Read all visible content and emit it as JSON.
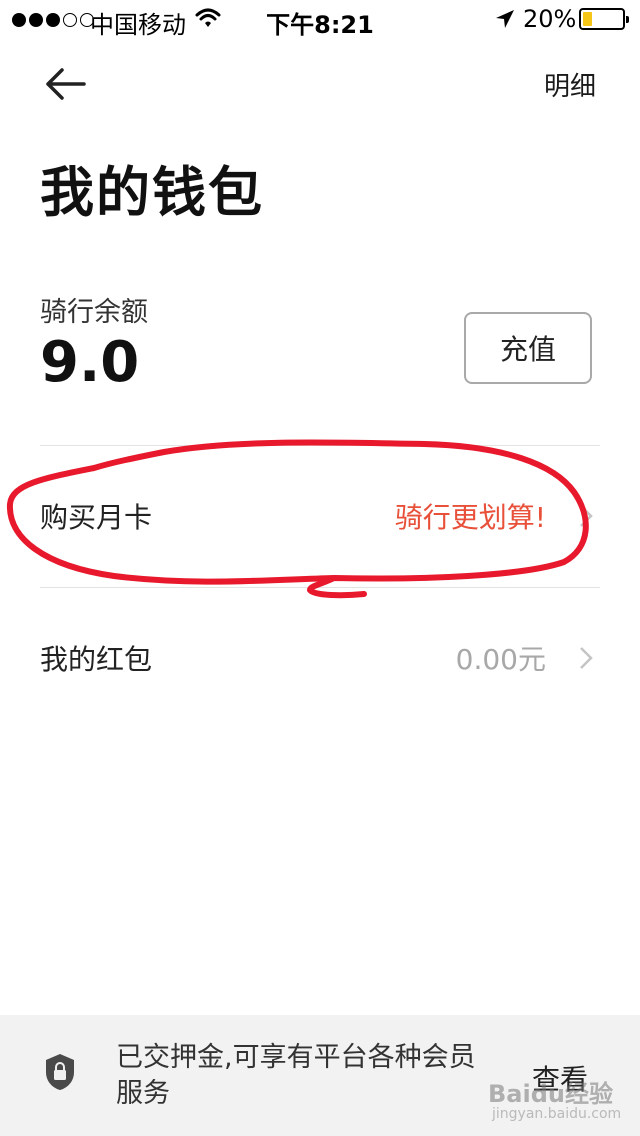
{
  "status_bar": {
    "carrier": "中国移动",
    "time": "下午8:21",
    "battery": "20%",
    "battery_level": 0.2,
    "icons": [
      "signal-dots",
      "wifi-icon",
      "location-arrow-icon",
      "battery-icon"
    ]
  },
  "nav": {
    "back_icon": "arrow-left-icon",
    "detail_label": "明细"
  },
  "page_title": "我的钱包",
  "balance": {
    "label": "骑行余额",
    "value": "9.0",
    "recharge_label": "充值"
  },
  "rows": [
    {
      "label": "购买月卡",
      "value": "骑行更划算!",
      "value_color": "#e8503a"
    },
    {
      "label": "我的红包",
      "value": "0.00元",
      "value_color": "#a8a8a8"
    }
  ],
  "annotation_color": "#e8192c",
  "footer": {
    "icon": "shield-lock-icon",
    "text": "已交押金,可享有平台各种会员服务",
    "action_label": "查看"
  },
  "watermark": {
    "text": "Baidu经验",
    "sub": "jingyan.baidu.com"
  }
}
